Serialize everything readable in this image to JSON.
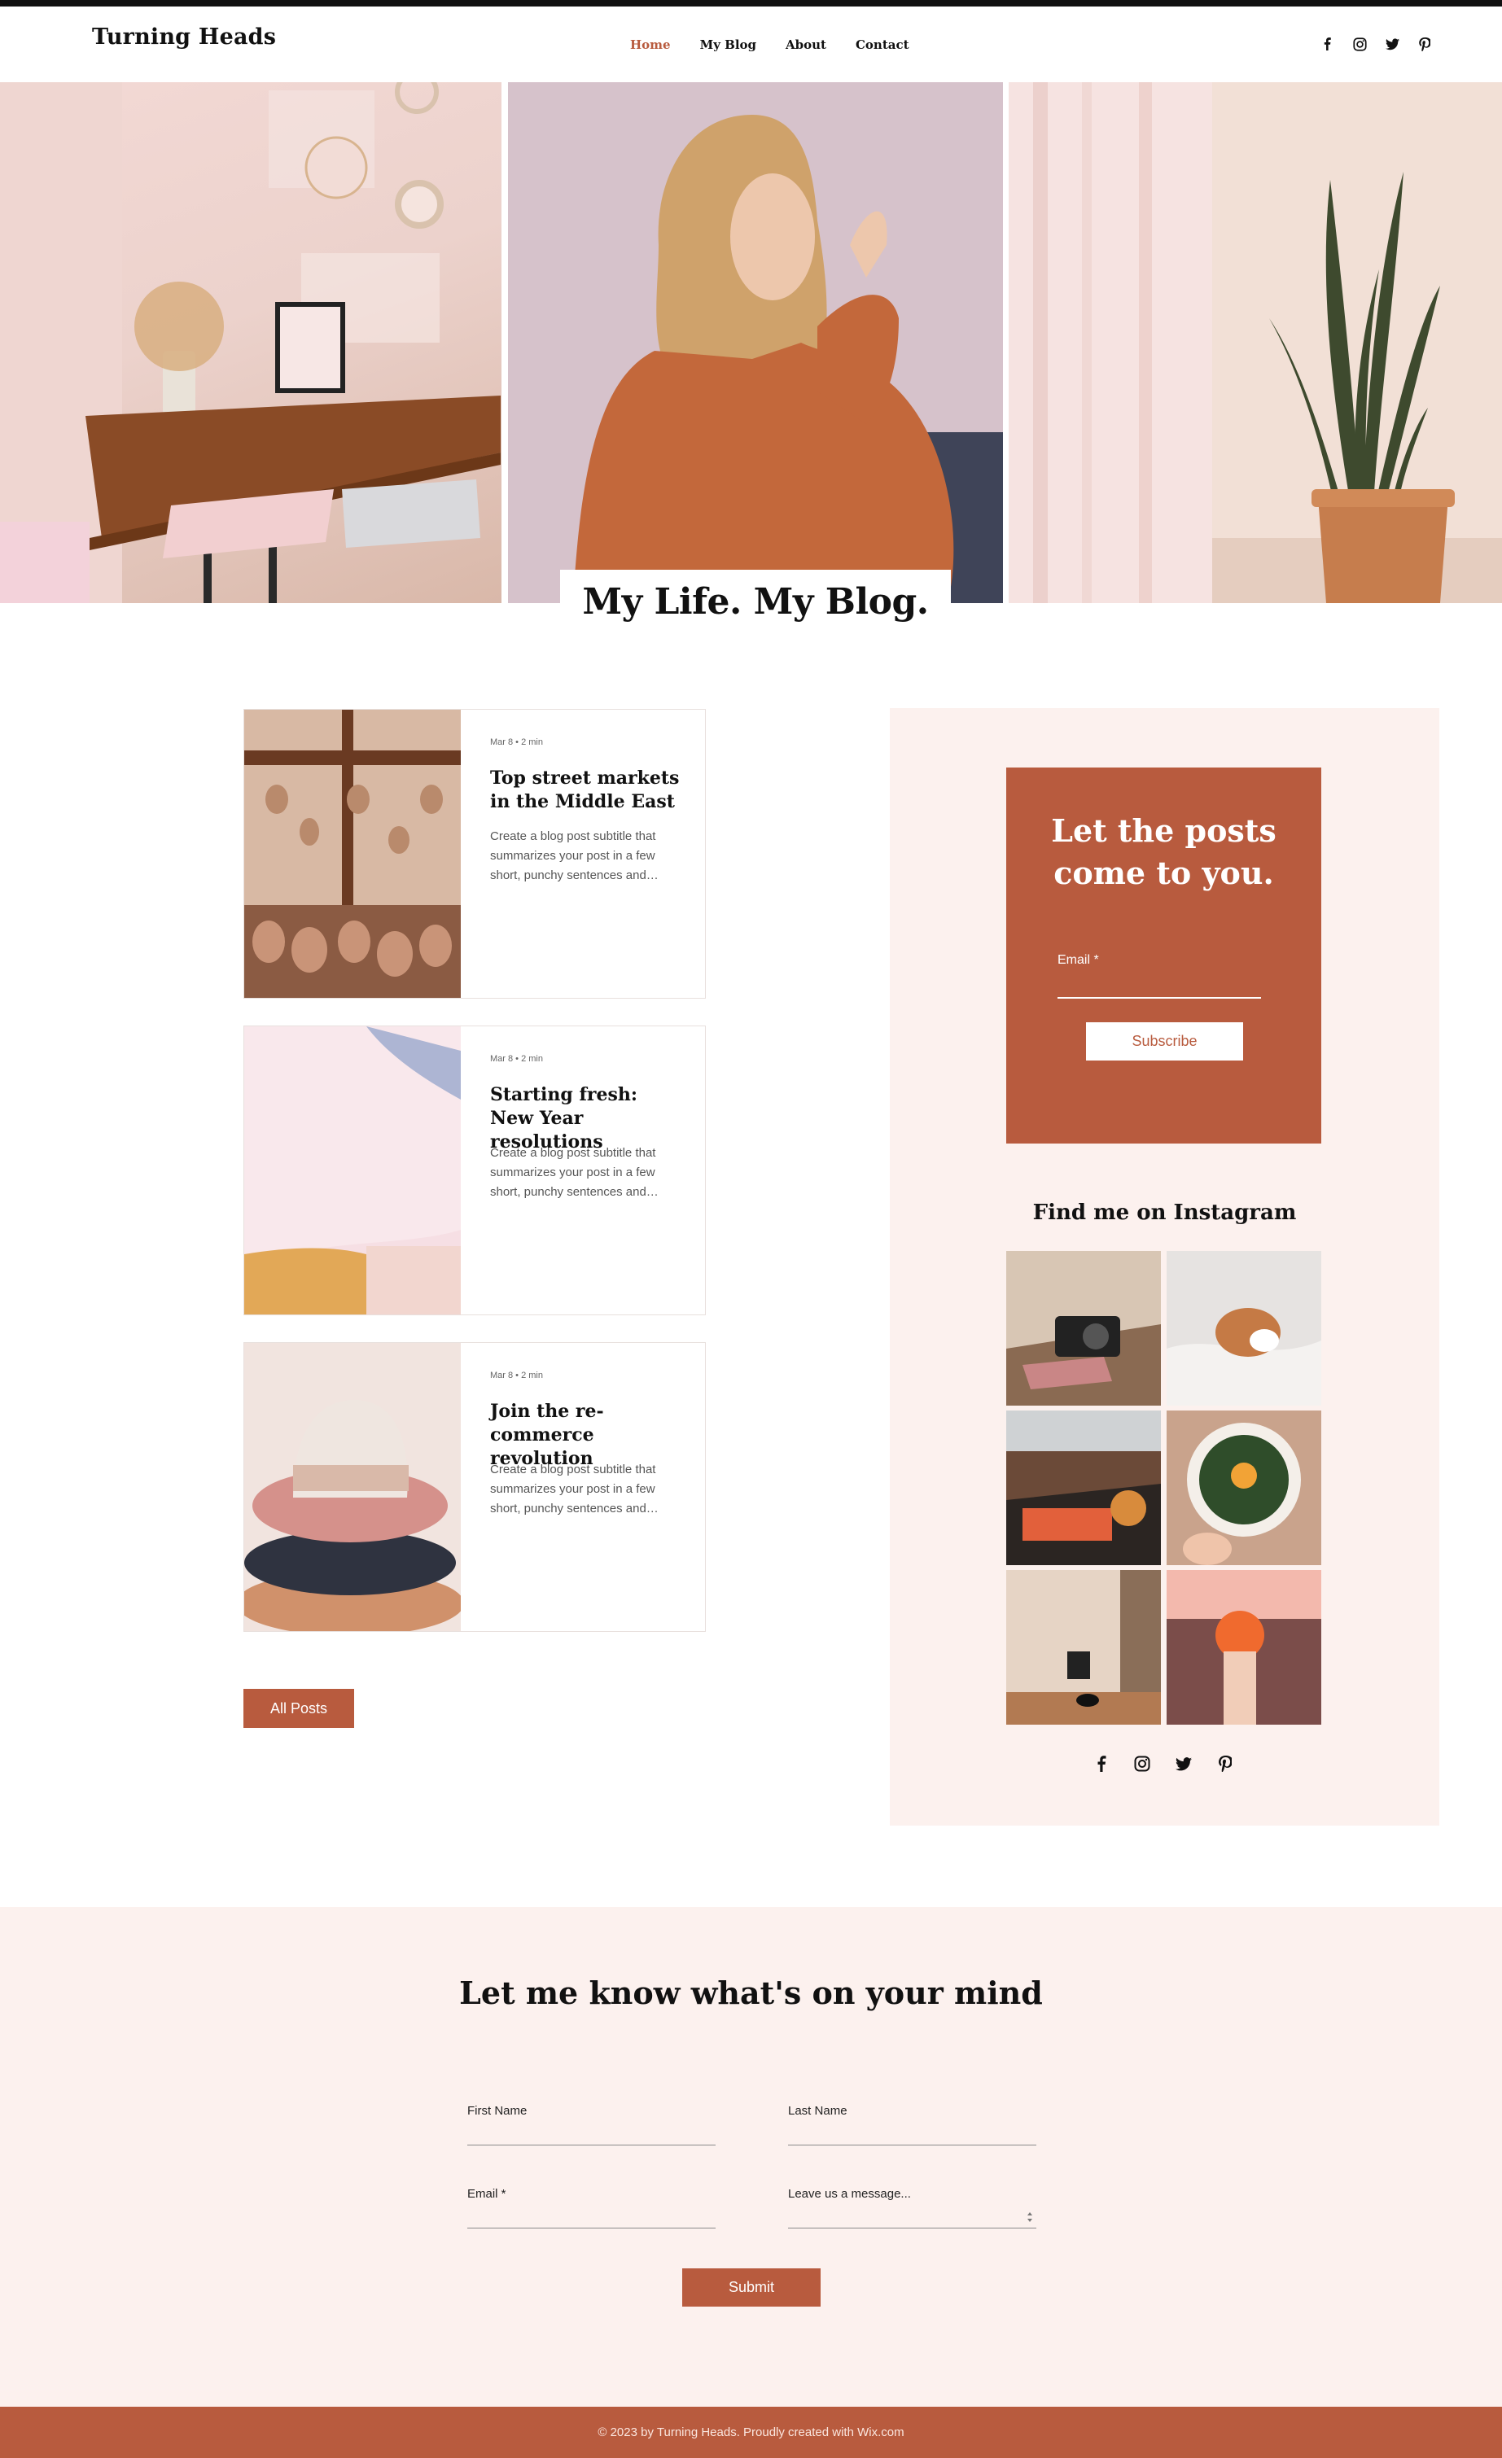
{
  "brand": {
    "accent": "#b85b3e",
    "blush": "#fcf1ee"
  },
  "header": {
    "logo": "Turning Heads",
    "nav": [
      "Home",
      "My Blog",
      "About",
      "Contact"
    ],
    "social": [
      "facebook-icon",
      "instagram-icon",
      "twitter-icon",
      "pinterest-icon"
    ]
  },
  "hero": {
    "title": "My Life. My Blog."
  },
  "posts": [
    {
      "meta": "Mar 8 • 2 min",
      "title": "Top street markets in the Middle East",
      "subtitle": "Create a blog post subtitle that summarizes your post in a few short, punchy sentences and…"
    },
    {
      "meta": "Mar 8 • 2 min",
      "title": "Starting fresh: New Year resolutions",
      "subtitle": "Create a blog post subtitle that summarizes your post in a few short, punchy sentences and…"
    },
    {
      "meta": "Mar 8 • 2 min",
      "title": "Join the re-commerce revolution",
      "subtitle": "Create a blog post subtitle that summarizes your post in a few short, punchy sentences and…"
    }
  ],
  "all_posts_label": "All Posts",
  "subscribe": {
    "heading": "Let the posts come to you.",
    "email_label": "Email *",
    "button": "Subscribe"
  },
  "instagram": {
    "title": "Find me on Instagram"
  },
  "contact": {
    "heading": "Let me know what's on your mind",
    "first_name": "First Name",
    "last_name": "Last Name",
    "email": "Email *",
    "message": "Leave us a message...",
    "submit": "Submit"
  },
  "footer": {
    "text": "© 2023 by Turning Heads. Proudly created with Wix.com"
  }
}
